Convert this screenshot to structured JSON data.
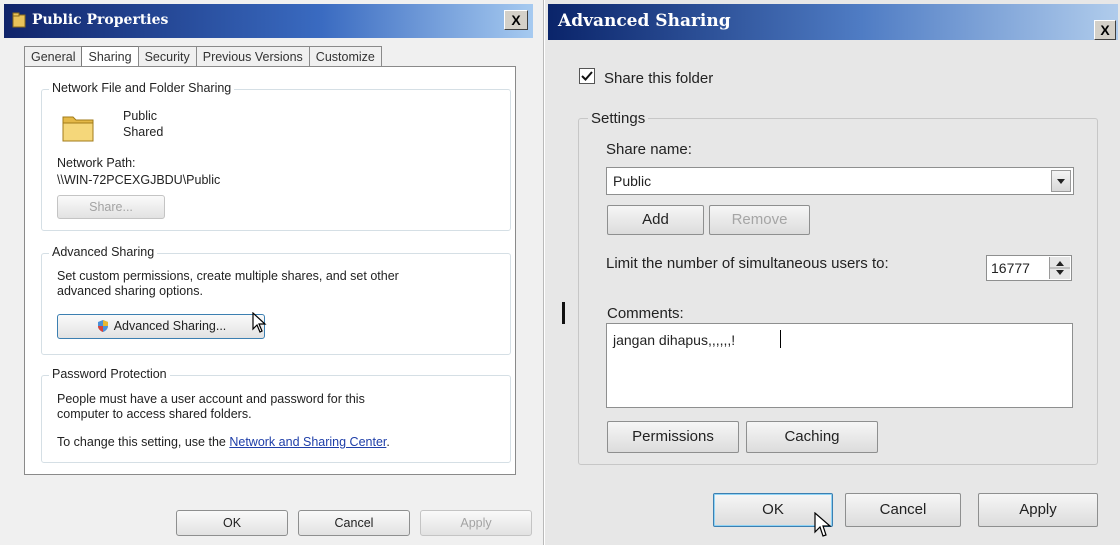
{
  "left_dialog": {
    "title": "Public Properties",
    "close_label": "X",
    "tabs": [
      {
        "label": "General",
        "active": false
      },
      {
        "label": "Sharing",
        "active": true
      },
      {
        "label": "Security",
        "active": false
      },
      {
        "label": "Previous Versions",
        "active": false
      },
      {
        "label": "Customize",
        "active": false
      }
    ],
    "network_sharing": {
      "group_title": "Network File and Folder Sharing",
      "folder_name": "Public",
      "folder_status": "Shared",
      "path_label": "Network Path:",
      "path_value": "\\\\WIN-72PCEXGJBDU\\Public",
      "share_button": "Share..."
    },
    "advanced_sharing": {
      "group_title": "Advanced Sharing",
      "description_line1": "Set custom permissions, create multiple shares, and set other",
      "description_line2": "advanced sharing options.",
      "button": "Advanced Sharing..."
    },
    "password_protection": {
      "group_title": "Password Protection",
      "line1": "People must have a user account and password for this",
      "line2": "computer to access shared folders.",
      "line3_prefix": "To change this setting, use the ",
      "link": "Network and Sharing Center",
      "line3_suffix": "."
    },
    "footer": {
      "ok": "OK",
      "cancel": "Cancel",
      "apply": "Apply"
    }
  },
  "right_dialog": {
    "title": "Advanced Sharing",
    "close_label": "X",
    "share_checkbox_label": "Share this folder",
    "share_checked": true,
    "settings_title": "Settings",
    "share_name_label": "Share name:",
    "share_name_value": "Public",
    "add_button": "Add",
    "remove_button": "Remove",
    "limit_label": "Limit the number of simultaneous users to:",
    "limit_value": "16777",
    "comments_label": "Comments:",
    "comments_value": "jangan dihapus,,,,,,!",
    "permissions_button": "Permissions",
    "caching_button": "Caching",
    "footer": {
      "ok": "OK",
      "cancel": "Cancel",
      "apply": "Apply"
    }
  }
}
